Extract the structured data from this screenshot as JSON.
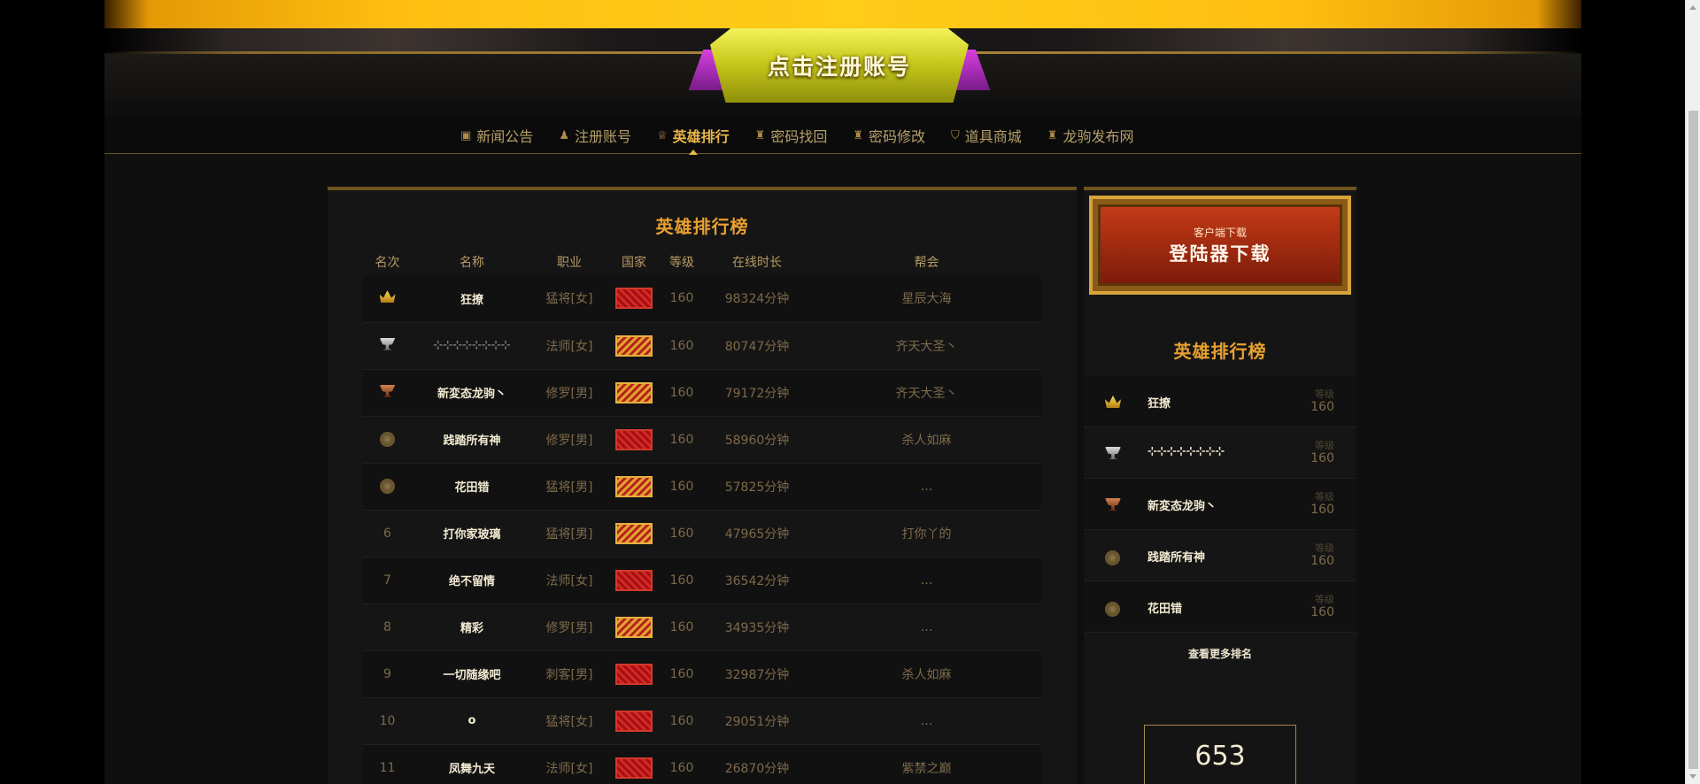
{
  "header": {
    "register_cta": "点击注册账号"
  },
  "nav": [
    {
      "label": "新闻公告",
      "icon": "news-icon",
      "glyph": "▣",
      "active": false
    },
    {
      "label": "注册账号",
      "icon": "user-icon",
      "glyph": "♟",
      "active": false
    },
    {
      "label": "英雄排行",
      "icon": "trophy-icon",
      "glyph": "♕",
      "active": true
    },
    {
      "label": "密码找回",
      "icon": "key-icon",
      "glyph": "♜",
      "active": false
    },
    {
      "label": "密码修改",
      "icon": "lock-icon",
      "glyph": "♜",
      "active": false
    },
    {
      "label": "道具商城",
      "icon": "shield-icon",
      "glyph": "⛉",
      "active": false
    },
    {
      "label": "龙驹发布网",
      "icon": "person-icon",
      "glyph": "♜",
      "active": false
    }
  ],
  "ranking": {
    "title": "英雄排行榜",
    "columns": [
      "名次",
      "名称",
      "职业",
      "国家",
      "等级",
      "在线时长",
      "帮会"
    ],
    "rows": [
      {
        "rank": "",
        "medal": "gold",
        "name": "狂撩",
        "job": "猛将[女]",
        "flag": "red",
        "level": "160",
        "time": "98324分钟",
        "guild": "星辰大海"
      },
      {
        "rank": "",
        "medal": "silver",
        "name": "⊹⊹⊹⊹⊹⊹⊹⊹",
        "job": "法师[女]",
        "flag": "yellow",
        "level": "160",
        "time": "80747分钟",
        "guild": "齐天大圣丶"
      },
      {
        "rank": "",
        "medal": "bronze",
        "name": "新変态龙驹丶",
        "job": "修罗[男]",
        "flag": "yellow",
        "level": "160",
        "time": "79172分钟",
        "guild": "齐天大圣丶"
      },
      {
        "rank": "",
        "medal": "coin",
        "name": "践踏所有神",
        "job": "修罗[男]",
        "flag": "red",
        "level": "160",
        "time": "58960分钟",
        "guild": "杀人如麻"
      },
      {
        "rank": "",
        "medal": "coin",
        "name": "花田错",
        "job": "猛将[男]",
        "flag": "yellow",
        "level": "160",
        "time": "57825分钟",
        "guild": "…"
      },
      {
        "rank": "6",
        "medal": "",
        "name": "打你家玻璃",
        "job": "猛将[男]",
        "flag": "yellow",
        "level": "160",
        "time": "47965分钟",
        "guild": "打你丫的"
      },
      {
        "rank": "7",
        "medal": "",
        "name": "绝不留情",
        "job": "法师[女]",
        "flag": "red",
        "level": "160",
        "time": "36542分钟",
        "guild": "…"
      },
      {
        "rank": "8",
        "medal": "",
        "name": "精彩",
        "job": "修罗[男]",
        "flag": "yellow",
        "level": "160",
        "time": "34935分钟",
        "guild": "…"
      },
      {
        "rank": "9",
        "medal": "",
        "name": "一切随缘吧",
        "job": "刺客[男]",
        "flag": "red",
        "level": "160",
        "time": "32987分钟",
        "guild": "杀人如麻"
      },
      {
        "rank": "10",
        "medal": "",
        "name": "o",
        "job": "猛将[女]",
        "flag": "red",
        "level": "160",
        "time": "29051分钟",
        "guild": "…"
      },
      {
        "rank": "11",
        "medal": "",
        "name": "凤舞九天",
        "job": "法师[女]",
        "flag": "red",
        "level": "160",
        "time": "26870分钟",
        "guild": "紫禁之巅"
      }
    ]
  },
  "sidebar": {
    "download_sub": "客户端下载",
    "download_main": "登陆器下载",
    "title": "英雄排行榜",
    "level_label": "等级",
    "items": [
      {
        "medal": "gold",
        "name": "狂撩",
        "level": "160"
      },
      {
        "medal": "silver",
        "name": "⊹⊹⊹⊹⊹⊹⊹⊹",
        "level": "160"
      },
      {
        "medal": "bronze",
        "name": "新変态龙驹丶",
        "level": "160"
      },
      {
        "medal": "coin",
        "name": "践踏所有神",
        "level": "160"
      },
      {
        "medal": "coin",
        "name": "花田错",
        "level": "160"
      }
    ],
    "more_link": "查看更多排名",
    "counter": "653"
  },
  "colors": {
    "accent_gold": "#e8a030",
    "banner_yellow": "#ffcc18",
    "download_red": "#c33a16"
  }
}
